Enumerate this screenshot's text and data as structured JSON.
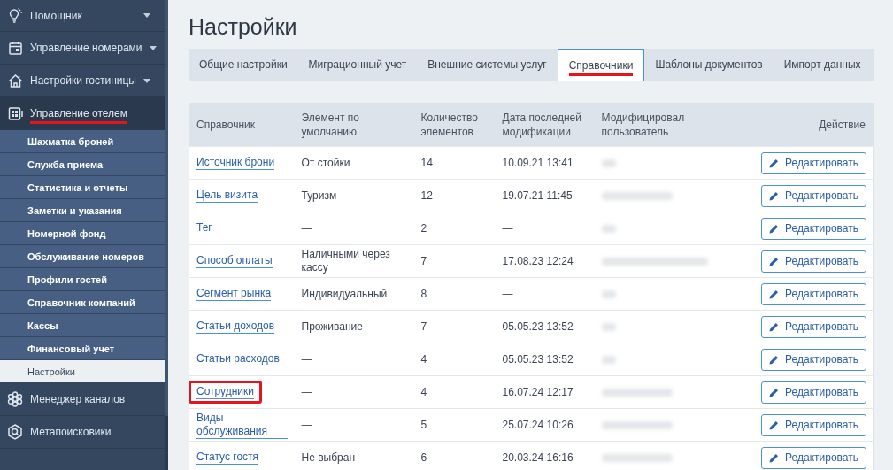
{
  "sidebar": {
    "items": [
      {
        "label": "Помощник",
        "kind": "menu",
        "selected": false,
        "underlined": false
      },
      {
        "label": "Управление номерами",
        "kind": "menu",
        "selected": false,
        "underlined": false
      },
      {
        "label": "Настройки гостиницы",
        "kind": "menu",
        "selected": false,
        "underlined": false
      },
      {
        "label": "Управление отелем",
        "kind": "link",
        "selected": true,
        "underlined": true,
        "children": [
          {
            "label": "Шахматка броней",
            "selected": false
          },
          {
            "label": "Служба приема",
            "selected": false
          },
          {
            "label": "Статистика и отчеты",
            "selected": false
          },
          {
            "label": "Заметки и указания",
            "selected": false
          },
          {
            "label": "Номерной фонд",
            "selected": false
          },
          {
            "label": "Обслуживание номеров",
            "selected": false
          },
          {
            "label": "Профили гостей",
            "selected": false
          },
          {
            "label": "Справочник компаний",
            "selected": false
          },
          {
            "label": "Кассы",
            "selected": false
          },
          {
            "label": "Финансовый учет",
            "selected": false
          },
          {
            "label": "Настройки",
            "selected": true
          }
        ]
      },
      {
        "label": "Менеджер каналов",
        "kind": "link",
        "selected": false,
        "underlined": false
      },
      {
        "label": "Метапоисковики",
        "kind": "link",
        "selected": false,
        "underlined": false
      }
    ]
  },
  "page": {
    "title": "Настройки"
  },
  "tabs": [
    {
      "label": "Общие настройки",
      "selected": false,
      "underlined": false
    },
    {
      "label": "Миграционный учет",
      "selected": false,
      "underlined": false
    },
    {
      "label": "Внешние системы услуг",
      "selected": false,
      "underlined": false
    },
    {
      "label": "Справочники",
      "selected": true,
      "underlined": true
    },
    {
      "label": "Шаблоны документов",
      "selected": false,
      "underlined": false
    },
    {
      "label": "Импорт данных",
      "selected": false,
      "underlined": false
    }
  ],
  "table": {
    "columns": [
      "Справочник",
      "Элемент по умолчанию",
      "Количество элементов",
      "Дата последней модификации",
      "Модифицировал пользователь",
      "Действие"
    ],
    "rows": [
      {
        "name": "Источник брони",
        "default": "От стойки",
        "count": "14",
        "date": "10.09.21 13:41",
        "action": "Редактировать",
        "outlined": false
      },
      {
        "name": "Цель визита",
        "default": "Туризм",
        "count": "12",
        "date": "19.07.21 11:45",
        "action": "Редактировать",
        "outlined": false
      },
      {
        "name": "Тег",
        "default": "—",
        "count": "2",
        "date": "—",
        "action": "Редактировать",
        "outlined": false
      },
      {
        "name": "Способ оплаты",
        "default": "Наличными через кассу",
        "count": "7",
        "date": "17.08.23 12:24",
        "action": "Редактировать",
        "outlined": false
      },
      {
        "name": "Сегмент рынка",
        "default": "Индивидуальный",
        "count": "8",
        "date": "—",
        "action": "Редактировать",
        "outlined": false
      },
      {
        "name": "Статьи доходов",
        "default": "Проживание",
        "count": "7",
        "date": "05.05.23 13:52",
        "action": "Редактировать",
        "outlined": false
      },
      {
        "name": "Статьи расходов",
        "default": "—",
        "count": "4",
        "date": "05.05.23 13:52",
        "action": "Редактировать",
        "outlined": false
      },
      {
        "name": "Сотрудники",
        "default": "—",
        "count": "4",
        "date": "16.07.24 12:17",
        "action": "Редактировать",
        "outlined": true
      },
      {
        "name": "Виды обслуживания",
        "default": "—",
        "count": "5",
        "date": "25.07.24 10:26",
        "action": "Редактировать",
        "outlined": false
      },
      {
        "name": "Статус гостя",
        "default": "Не выбран",
        "count": "6",
        "date": "20.03.24 16:16",
        "action": "Редактировать",
        "outlined": false
      }
    ]
  }
}
